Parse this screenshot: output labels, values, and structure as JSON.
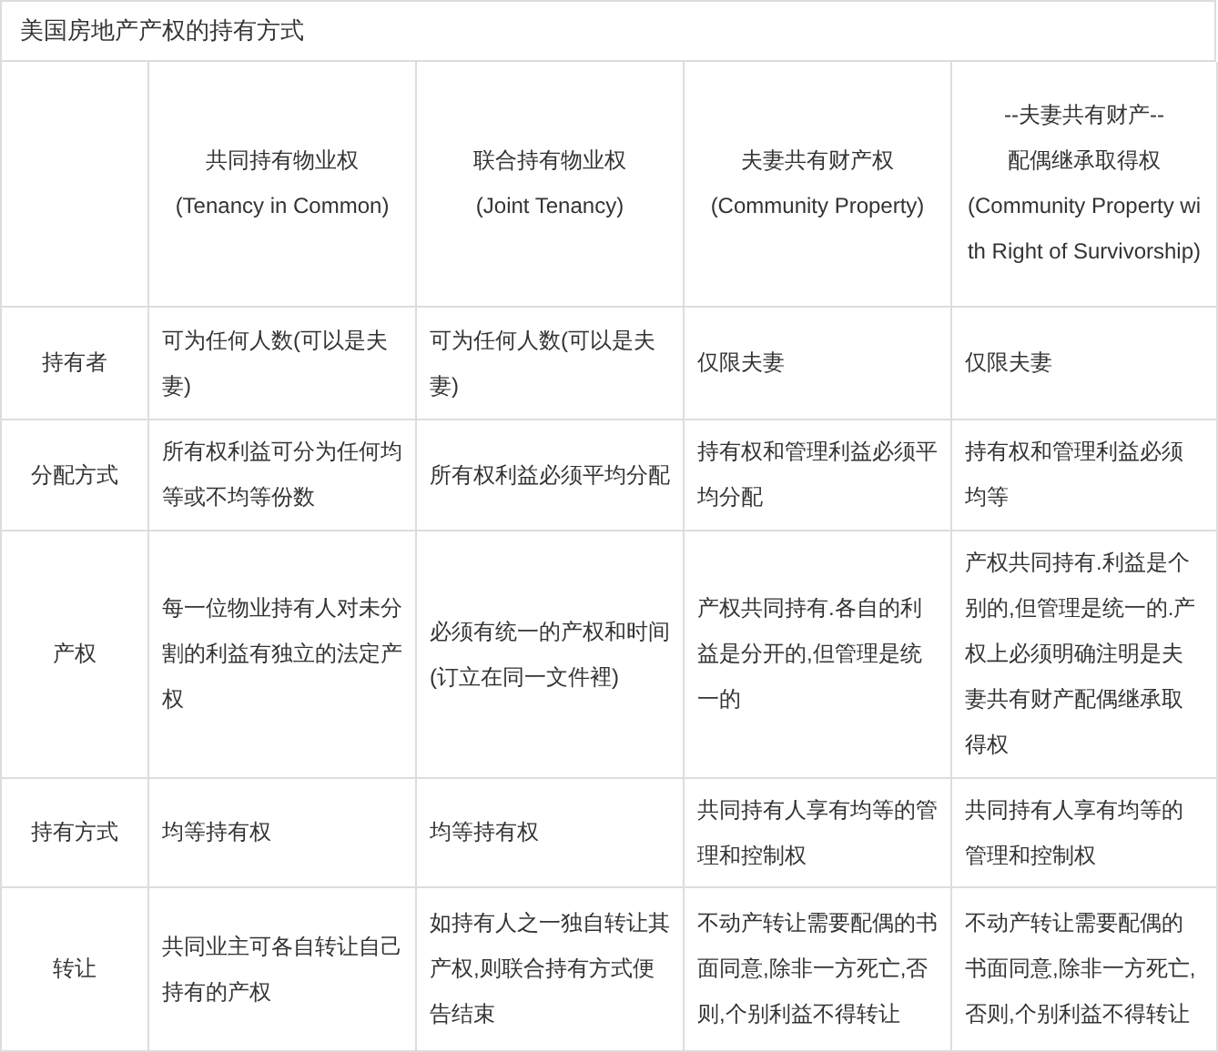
{
  "title": "美国房地产产权的持有方式",
  "columns": [
    "共同持有物业权\n(Tenancy in Common)",
    "联合持有物业权\n(Joint Tenancy)",
    "夫妻共有财产权\n(Community Property)",
    "--夫妻共有财产--\n配偶继承取得权\n(Community Property with Right of Survivorship)"
  ],
  "rows": [
    {
      "label": "持有者",
      "cells": [
        "可为任何人数(可以是夫妻)",
        "可为任何人数(可以是夫妻)",
        "仅限夫妻",
        "仅限夫妻"
      ]
    },
    {
      "label": "分配方式",
      "cells": [
        "所有权利益可分为任何均等或不均等份数",
        "所有权利益必须平均分配",
        "持有权和管理利益必须平均分配",
        "持有权和管理利益必须均等"
      ]
    },
    {
      "label": "产权",
      "cells": [
        "每一位物业持有人对未分割的利益有独立的法定产权",
        "必须有统一的产权和时间(订立在同一文件裡)",
        "产权共同持有.各自的利益是分开的,但管理是统一的",
        "产权共同持有.利益是个别的,但管理是统一的.产权上必须明确注明是夫妻共有财产配偶继承取得权"
      ]
    },
    {
      "label": "持有方式",
      "cells": [
        "均等持有权",
        "均等持有权",
        "共同持有人享有均等的管理和控制权",
        "共同持有人享有均等的管理和控制权"
      ]
    },
    {
      "label": "转让",
      "cells": [
        "共同业主可各自转让自己持有的产权",
        "如持有人之一独自转让其产权,则联合持有方式便告结束",
        "不动产转让需要配偶的书面同意,除非一方死亡,否则,个别利益不得转让",
        "不动产转让需要配偶的书面同意,除非一方死亡,否则,个别利益不得转让"
      ]
    }
  ]
}
